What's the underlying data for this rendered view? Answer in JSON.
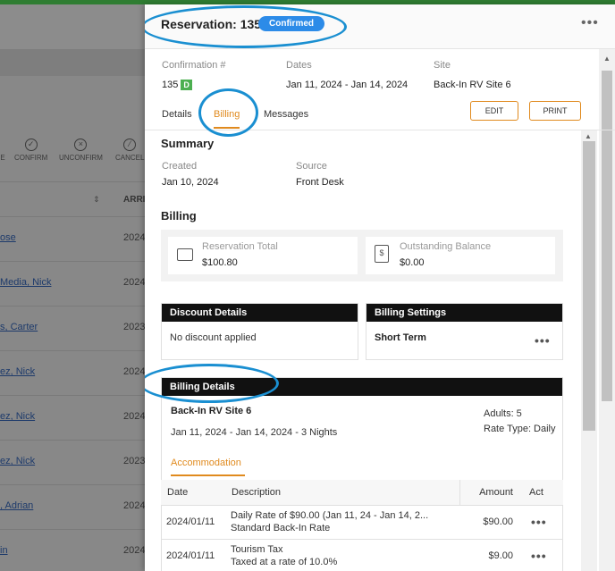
{
  "background": {
    "actions": [
      {
        "label": "E",
        "icon": "check-circle-icon"
      },
      {
        "label": "CONFIRM",
        "icon": "check-circle-icon"
      },
      {
        "label": "UNCONFIRM",
        "icon": "x-circle-icon"
      },
      {
        "label": "CANCEL",
        "icon": "cancel-circle-icon"
      }
    ],
    "column_header": "ARRI",
    "rows": [
      {
        "name": "ose",
        "year": "2024"
      },
      {
        "name": "Media, Nick",
        "year": "2024"
      },
      {
        "name": "s, Carter",
        "year": "2023"
      },
      {
        "name": "ez, Nick",
        "year": "2024"
      },
      {
        "name": "ez, Nick",
        "year": "2024"
      },
      {
        "name": "ez, Nick",
        "year": "2023"
      },
      {
        "name": ", Adrian",
        "year": "2024"
      },
      {
        "name": "in",
        "year": "2024"
      }
    ]
  },
  "header": {
    "title": "Reservation: 135",
    "status": "Confirmed",
    "more": "•••"
  },
  "meta": {
    "confirmation_label": "Confirmation #",
    "confirmation_value": "135",
    "confirmation_badge": "D",
    "dates_label": "Dates",
    "dates_value": "Jan 11, 2024 - Jan 14, 2024",
    "site_label": "Site",
    "site_value": "Back-In RV Site 6"
  },
  "tabs": [
    {
      "label": "Details",
      "active": false
    },
    {
      "label": "Billing",
      "active": true
    },
    {
      "label": "Messages",
      "active": false
    }
  ],
  "buttons": {
    "edit": "EDIT",
    "print": "PRINT"
  },
  "summary": {
    "heading": "Summary",
    "created_label": "Created",
    "created_value": "Jan 10, 2024",
    "source_label": "Source",
    "source_value": "Front Desk"
  },
  "billing": {
    "heading": "Billing",
    "total_label": "Reservation Total",
    "total_value": "$100.80",
    "balance_label": "Outstanding Balance",
    "balance_value": "$0.00"
  },
  "discount": {
    "heading": "Discount Details",
    "text": "No discount applied"
  },
  "settings": {
    "heading": "Billing Settings",
    "value": "Short Term"
  },
  "details": {
    "heading": "Billing Details",
    "site": "Back-In RV Site 6",
    "dates": "Jan 11, 2024 - Jan 14, 2024 - 3 Nights",
    "adults": "Adults: 5",
    "rate_type": "Rate Type: Daily",
    "subtab": "Accommodation",
    "columns": [
      "Date",
      "Description",
      "Amount",
      "Act"
    ],
    "rows": [
      {
        "date": "2024/01/11",
        "desc1": "Daily Rate of $90.00 (Jan 11, 24 - Jan 14, 2...",
        "desc2": "Standard Back-In Rate",
        "amount": "$90.00"
      },
      {
        "date": "2024/01/11",
        "desc1": "Tourism Tax",
        "desc2": "Taxed at a rate of 10.0%",
        "amount": "$9.00"
      }
    ]
  },
  "colors": {
    "accent": "#e08a1e",
    "badge": "#2c8be8",
    "annotation": "#1a8fd1"
  }
}
